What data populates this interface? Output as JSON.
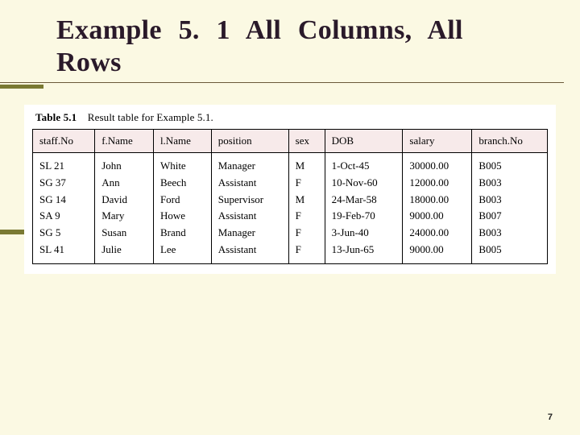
{
  "slide": {
    "title": "Example 5. 1 All Columns, All Rows",
    "page_number": "7"
  },
  "table": {
    "caption_label": "Table 5.1",
    "caption_text": "Result table for Example 5.1.",
    "headers": [
      "staff.No",
      "f.Name",
      "l.Name",
      "position",
      "sex",
      "DOB",
      "salary",
      "branch.No"
    ],
    "rows": [
      [
        "SL 21",
        "John",
        "White",
        "Manager",
        "M",
        "1-Oct-45",
        "30000.00",
        "B005"
      ],
      [
        "SG 37",
        "Ann",
        "Beech",
        "Assistant",
        "F",
        "10-Nov-60",
        "12000.00",
        "B003"
      ],
      [
        "SG 14",
        "David",
        "Ford",
        "Supervisor",
        "M",
        "24-Mar-58",
        "18000.00",
        "B003"
      ],
      [
        "SA 9",
        "Mary",
        "Howe",
        "Assistant",
        "F",
        "19-Feb-70",
        "9000.00",
        "B007"
      ],
      [
        "SG 5",
        "Susan",
        "Brand",
        "Manager",
        "F",
        "3-Jun-40",
        "24000.00",
        "B003"
      ],
      [
        "SL 41",
        "Julie",
        "Lee",
        "Assistant",
        "F",
        "13-Jun-65",
        "9000.00",
        "B005"
      ]
    ]
  },
  "chart_data": {
    "type": "table",
    "title": "Result table for Example 5.1.",
    "columns": [
      "staff.No",
      "f.Name",
      "l.Name",
      "position",
      "sex",
      "DOB",
      "salary",
      "branch.No"
    ],
    "rows": [
      [
        "SL 21",
        "John",
        "White",
        "Manager",
        "M",
        "1-Oct-45",
        30000.0,
        "B005"
      ],
      [
        "SG 37",
        "Ann",
        "Beech",
        "Assistant",
        "F",
        "10-Nov-60",
        12000.0,
        "B003"
      ],
      [
        "SG 14",
        "David",
        "Ford",
        "Supervisor",
        "M",
        "24-Mar-58",
        18000.0,
        "B003"
      ],
      [
        "SA 9",
        "Mary",
        "Howe",
        "Assistant",
        "F",
        "19-Feb-70",
        9000.0,
        "B007"
      ],
      [
        "SG 5",
        "Susan",
        "Brand",
        "Manager",
        "F",
        "3-Jun-40",
        24000.0,
        "B003"
      ],
      [
        "SL 41",
        "Julie",
        "Lee",
        "Assistant",
        "F",
        "13-Jun-65",
        9000.0,
        "B005"
      ]
    ]
  }
}
